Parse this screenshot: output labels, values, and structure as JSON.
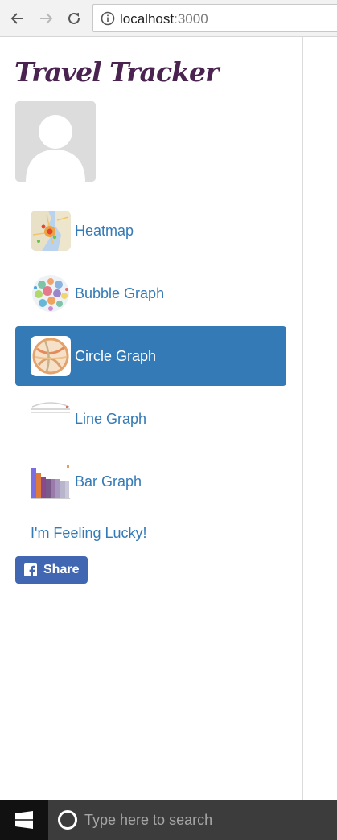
{
  "browser": {
    "address_host": "localhost",
    "address_port": ":3000"
  },
  "sidebar": {
    "title": "Travel Tracker",
    "nav_items": [
      {
        "label": "Heatmap",
        "icon": "heatmap-thumbnail",
        "active": false
      },
      {
        "label": "Bubble Graph",
        "icon": "bubble-graph-thumbnail",
        "active": false
      },
      {
        "label": "Circle Graph",
        "icon": "circle-graph-thumbnail",
        "active": true
      },
      {
        "label": "Line Graph",
        "icon": "line-graph-thumbnail",
        "active": false
      },
      {
        "label": "Bar Graph",
        "icon": "bar-graph-thumbnail",
        "active": false
      }
    ],
    "lucky_link": "I'm Feeling Lucky!",
    "share_label": "Share"
  },
  "taskbar": {
    "search_placeholder": "Type here to search"
  },
  "colors": {
    "title": "#4a2350",
    "link": "#337ab7",
    "active_bg": "#337ab7",
    "facebook": "#4267b2"
  }
}
